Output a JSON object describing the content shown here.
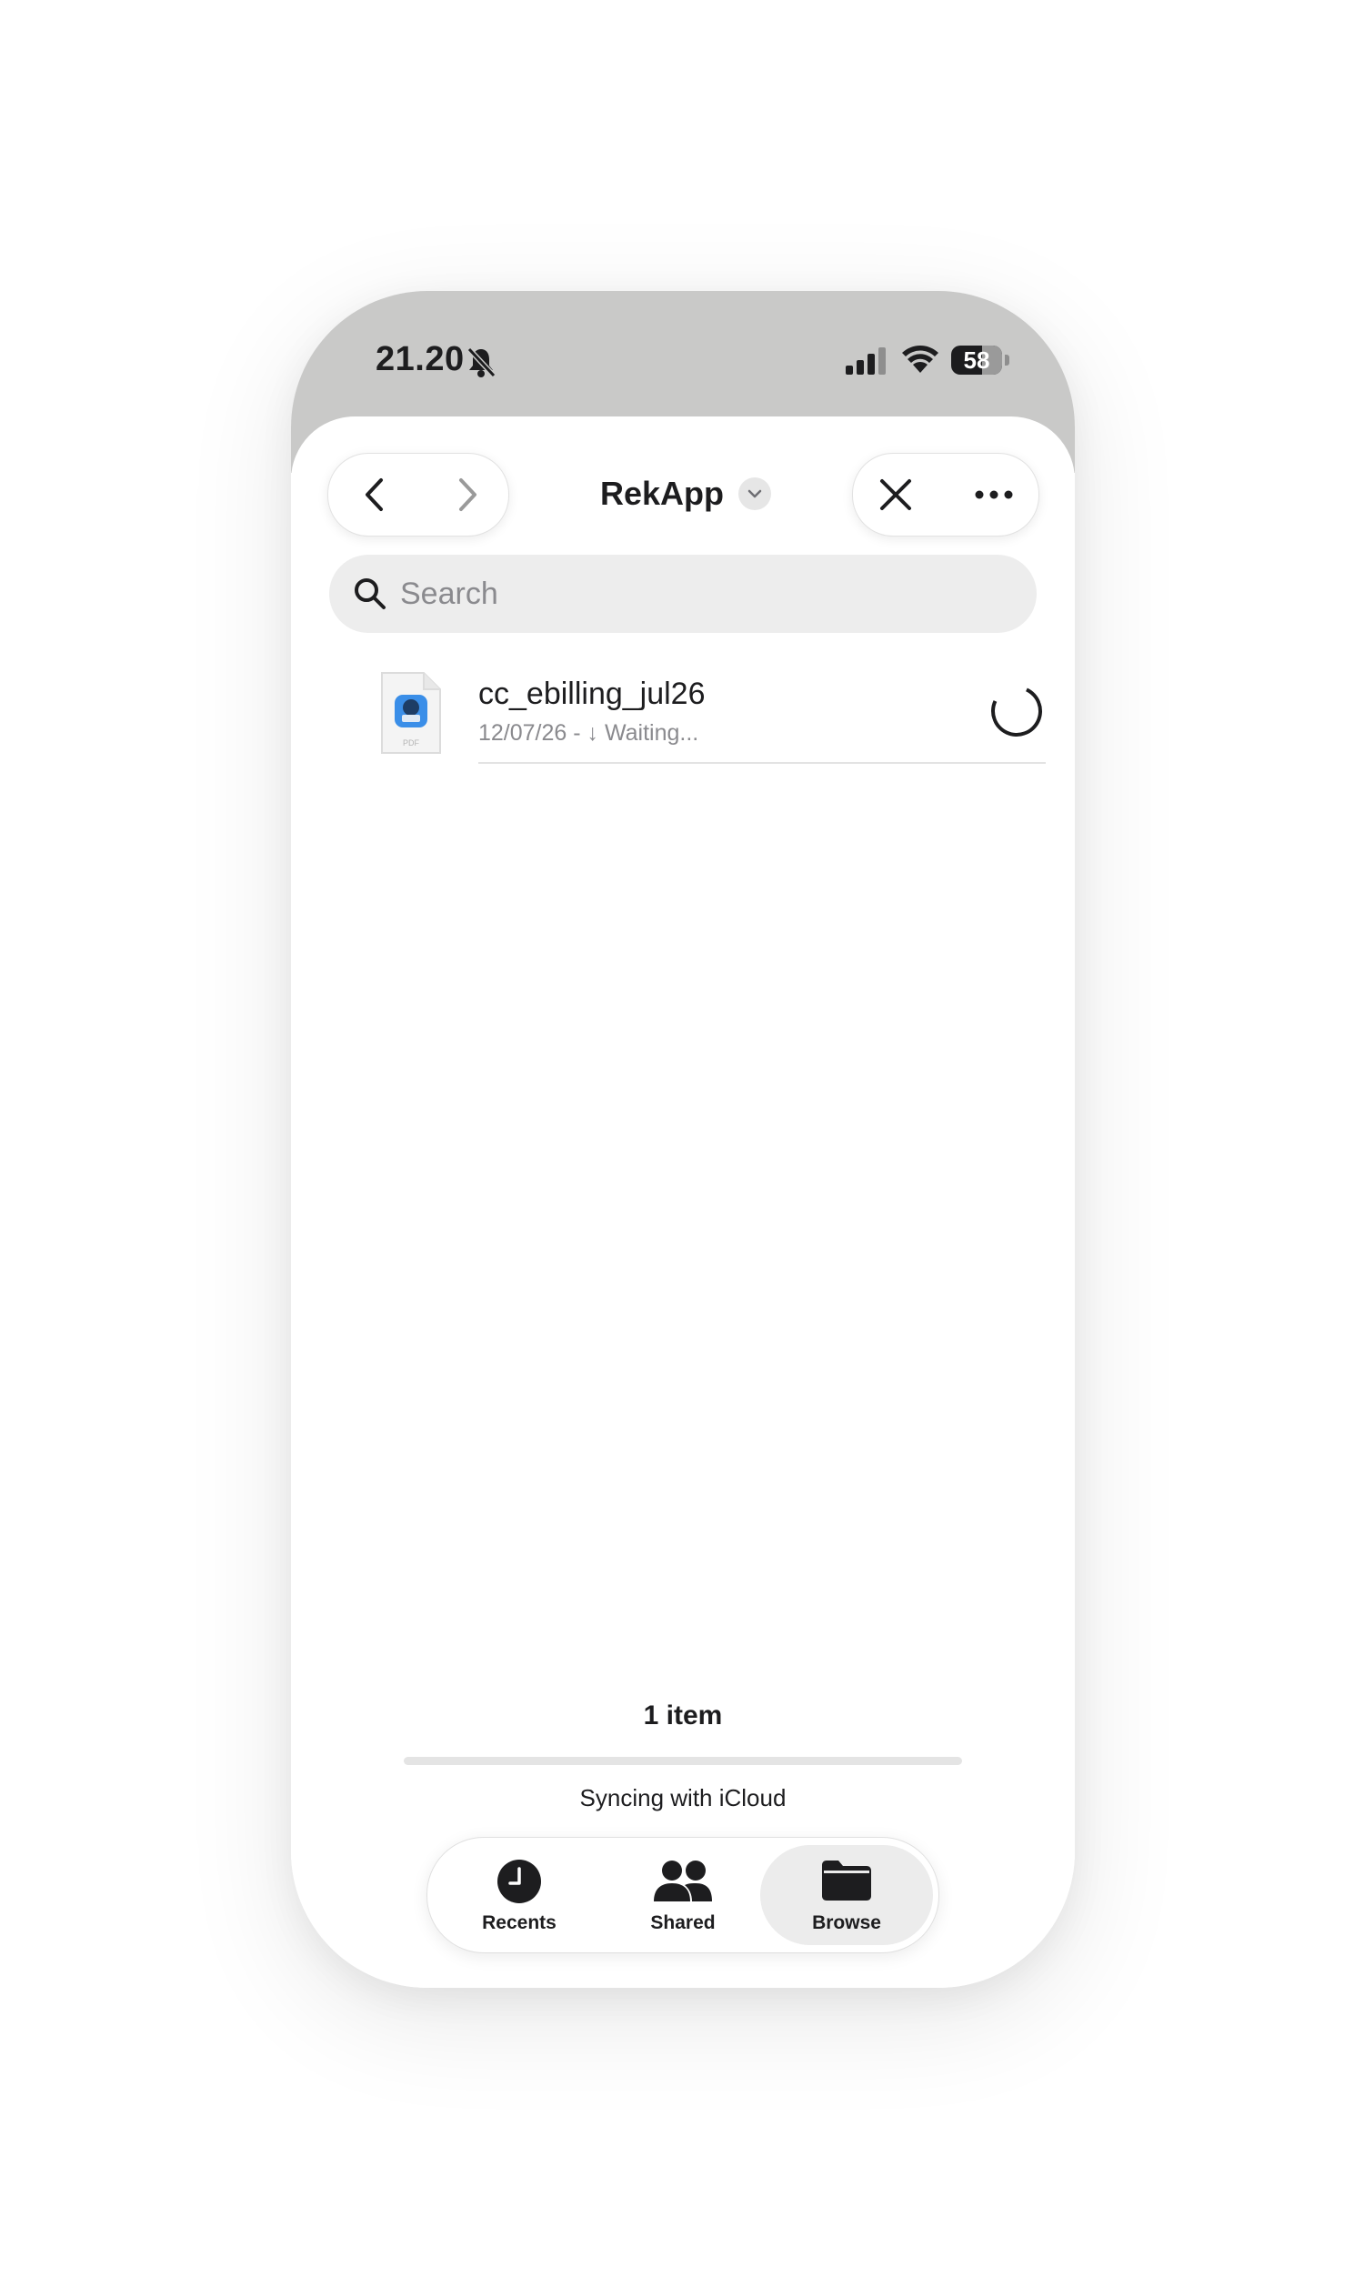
{
  "status_bar": {
    "time": "21.20",
    "battery_level": "58",
    "icons": [
      "bell-slash-icon",
      "cellular-signal-icon",
      "wifi-icon",
      "battery-icon"
    ]
  },
  "nav": {
    "title": "RekApp",
    "back_icon": "chevron-left-icon",
    "forward_icon": "chevron-right-icon",
    "close_icon": "close-icon",
    "more_icon": "ellipsis-icon"
  },
  "search": {
    "placeholder": "Search"
  },
  "files": [
    {
      "name": "cc_ebilling_jul26",
      "meta": "12/07/26 - ↓ Waiting...",
      "type_label": "PDF",
      "status_icon": "download-progress-icon"
    }
  ],
  "footer": {
    "item_count": "1 item",
    "sync_status": "Syncing with iCloud",
    "sync_progress": 0.0
  },
  "tabs": [
    {
      "label": "Recents",
      "icon": "clock-icon",
      "active": false
    },
    {
      "label": "Shared",
      "icon": "people-icon",
      "active": false
    },
    {
      "label": "Browse",
      "icon": "folder-icon",
      "active": true
    }
  ],
  "colors": {
    "status_bar_bg": "#c9c9c8",
    "search_bg": "#ededed",
    "active_tab_bg": "#ececec",
    "text_primary": "#1d1d1f",
    "text_secondary": "#8a8a8e"
  }
}
